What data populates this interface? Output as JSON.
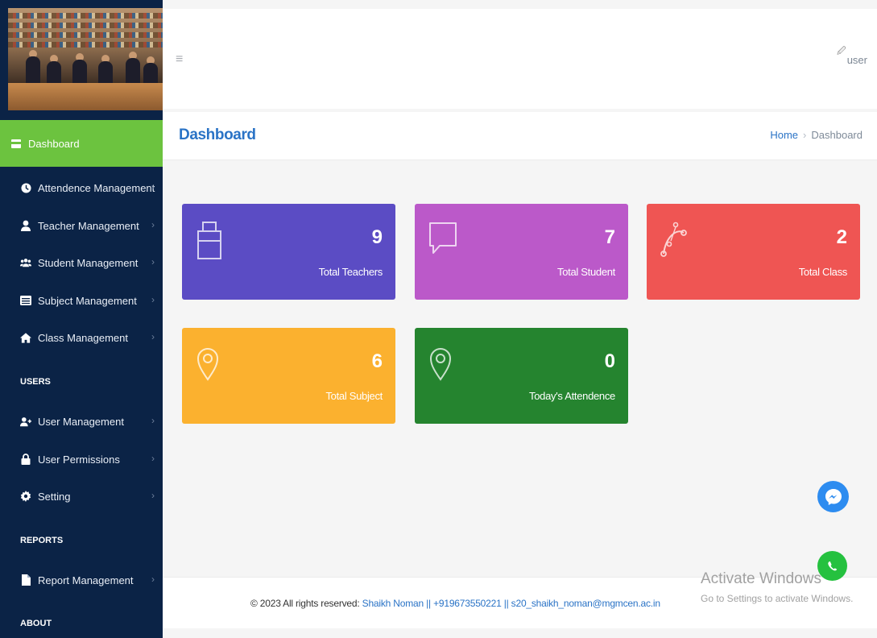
{
  "sidebar": {
    "active_item": {
      "label": "Dashboard",
      "icon": "dashboard-icon"
    },
    "items": [
      {
        "label": "Attendence Management",
        "icon": "clock-icon"
      },
      {
        "label": "Teacher Management",
        "icon": "user-icon"
      },
      {
        "label": "Student Management",
        "icon": "users-icon"
      },
      {
        "label": "Subject Management",
        "icon": "list-icon"
      },
      {
        "label": "Class Management",
        "icon": "home-icon"
      },
      {
        "label": "User Management",
        "icon": "user-plus-icon"
      },
      {
        "label": "User Permissions",
        "icon": "lock-icon"
      },
      {
        "label": "Setting",
        "icon": "gear-icon"
      },
      {
        "label": "Report Management",
        "icon": "file-icon"
      }
    ],
    "sections": {
      "users": "USERS",
      "reports": "REPORTS",
      "about": "ABOUT"
    }
  },
  "header": {
    "menu_icon": "hamburger-icon",
    "user_alt": "user"
  },
  "page": {
    "title": "Dashboard",
    "breadcrumb": {
      "home": "Home",
      "current": "Dashboard"
    }
  },
  "cards": [
    {
      "value": "9",
      "label": "Total Teachers",
      "color": "#5b4cc4",
      "icon": "bag-icon"
    },
    {
      "value": "7",
      "label": "Total Student",
      "color": "#bb59c9",
      "icon": "chat-icon"
    },
    {
      "value": "2",
      "label": "Total Class",
      "color": "#ef5553",
      "icon": "bezier-icon"
    },
    {
      "value": "6",
      "label": "Total Subject",
      "color": "#fbb12f",
      "icon": "map-pin-icon"
    },
    {
      "value": "0",
      "label": "Today's Attendence",
      "color": "#25842f",
      "icon": "map-pin-icon"
    }
  ],
  "footer": {
    "copyright": "© 2023 All rights reserved:",
    "contact": "Shaikh Noman || +919673550221 || s20_shaikh_noman@mgmcen.ac.in"
  },
  "watermark": {
    "title": "Activate Windows",
    "subtitle": "Go to Settings to activate Windows."
  },
  "floating": {
    "messenger_color": "#2d8cf0",
    "whatsapp_color": "#25c13f"
  }
}
